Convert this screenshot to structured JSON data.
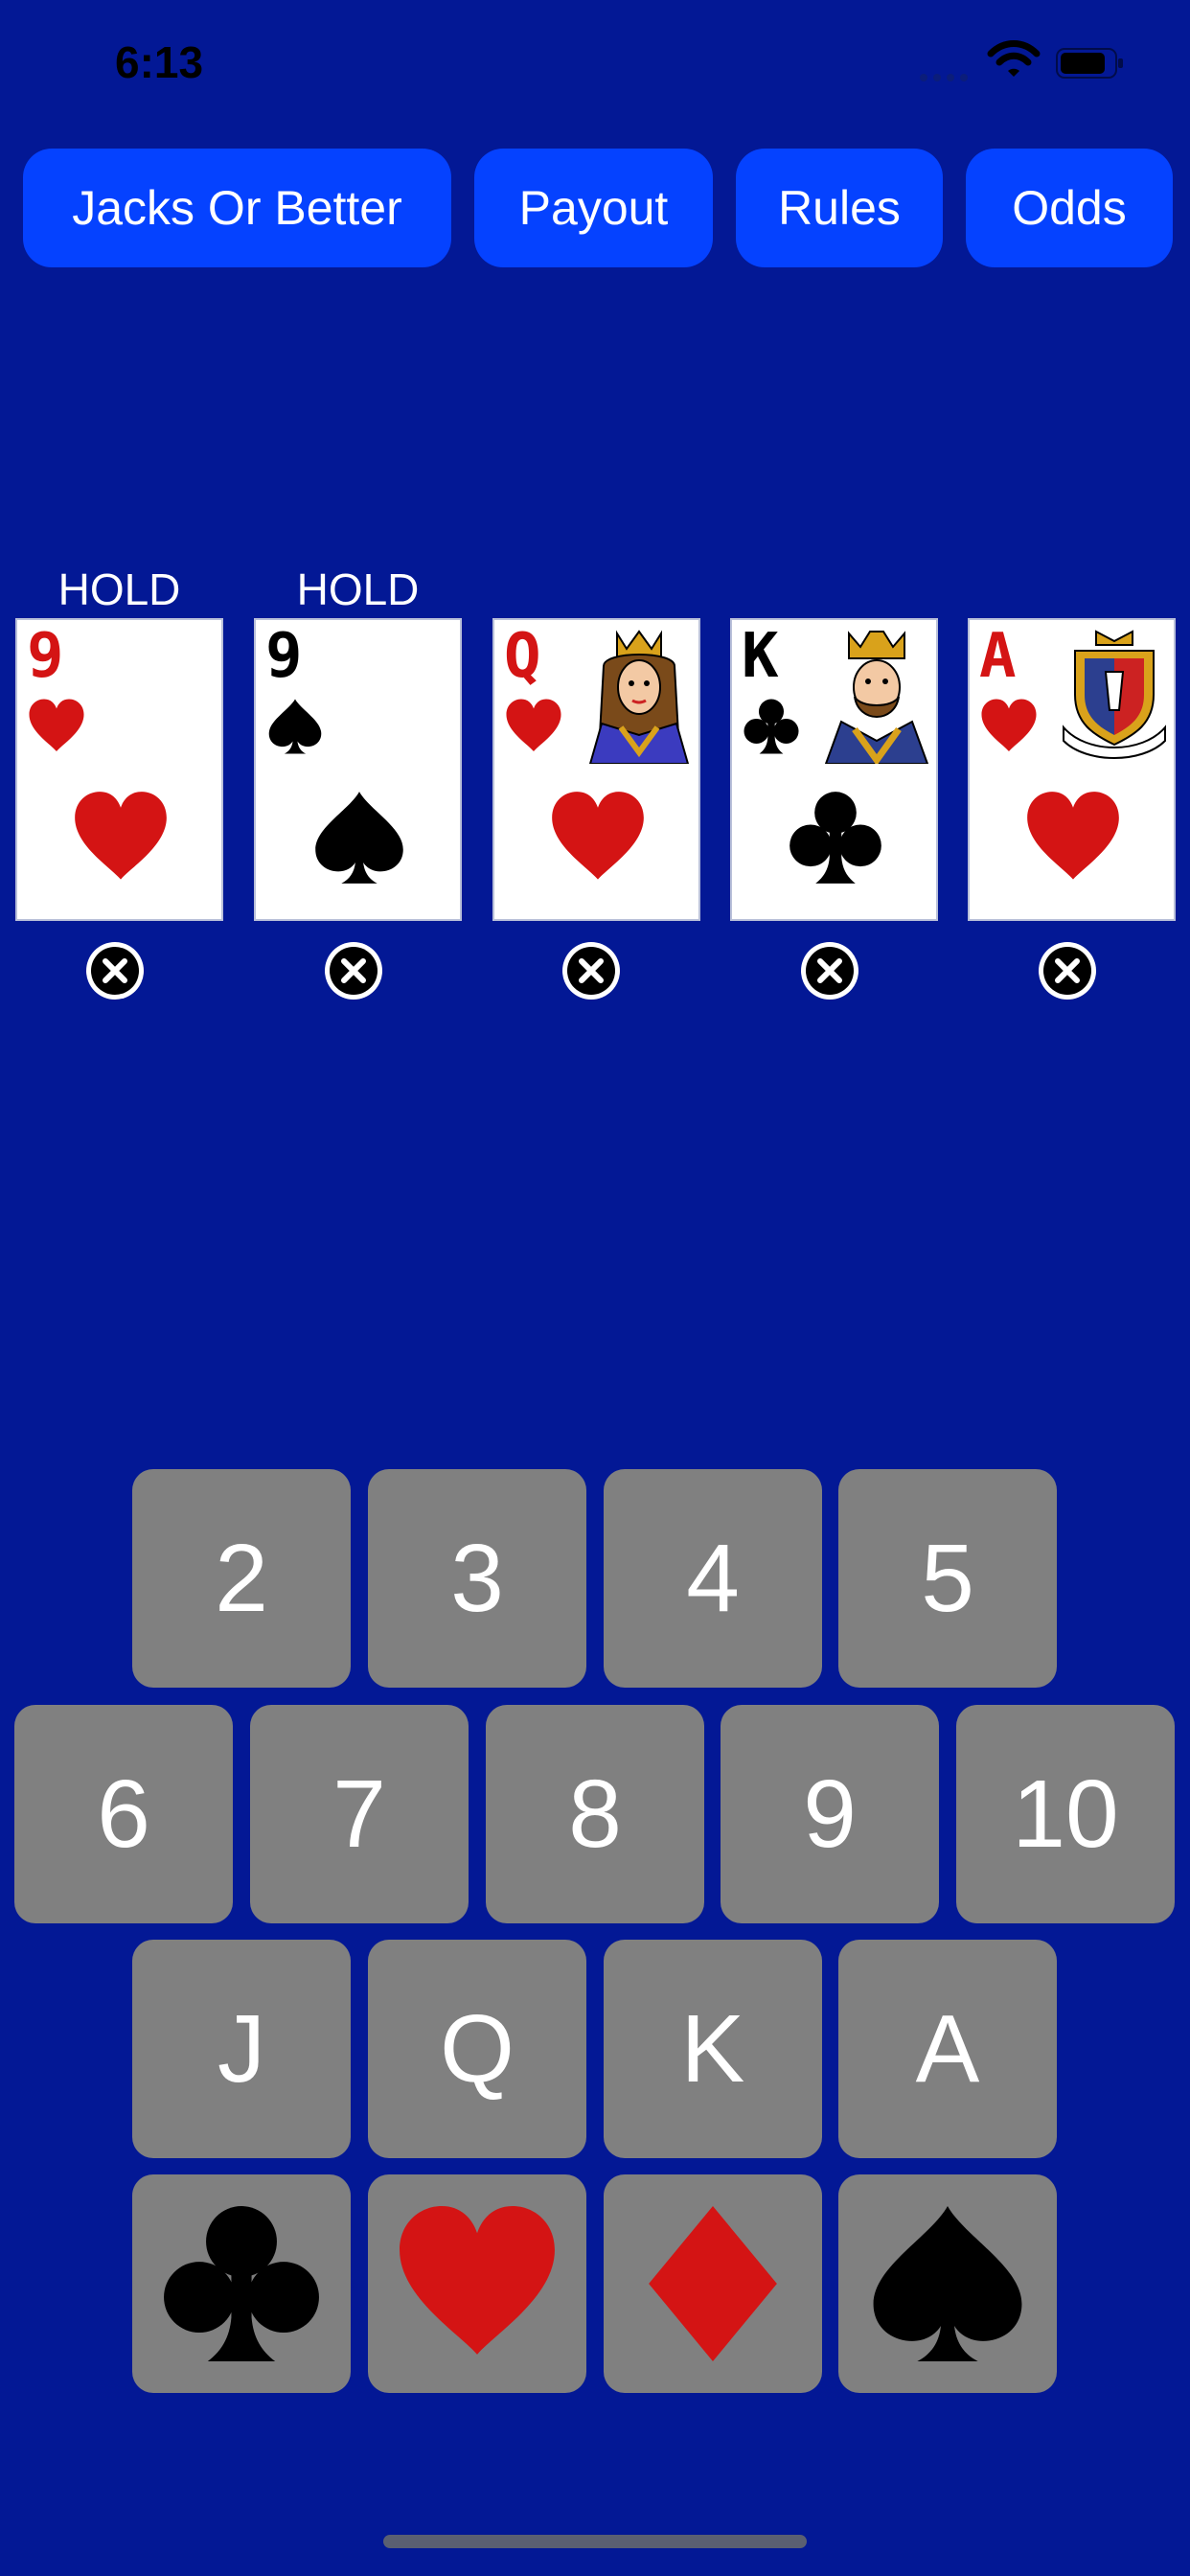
{
  "status_bar": {
    "time": "6:13"
  },
  "nav": {
    "game_button": "Jacks Or Better",
    "payout_button": "Payout",
    "rules_button": "Rules",
    "odds_button": "Odds"
  },
  "hand": [
    {
      "rank": "9",
      "suit": "hearts",
      "hold_label": "HOLD",
      "held": true
    },
    {
      "rank": "9",
      "suit": "spades",
      "hold_label": "HOLD",
      "held": true
    },
    {
      "rank": "Q",
      "suit": "hearts",
      "hold_label": "",
      "held": false
    },
    {
      "rank": "K",
      "suit": "clubs",
      "hold_label": "",
      "held": false
    },
    {
      "rank": "A",
      "suit": "hearts",
      "hold_label": "",
      "held": false
    }
  ],
  "keypad": {
    "ranks_row1": [
      "2",
      "3",
      "4",
      "5"
    ],
    "ranks_row2": [
      "6",
      "7",
      "8",
      "9",
      "10"
    ],
    "ranks_row3": [
      "J",
      "Q",
      "K",
      "A"
    ],
    "suits_row": [
      "clubs-icon",
      "hearts-icon",
      "diamonds-icon",
      "spades-icon"
    ]
  },
  "colors": {
    "background": "#031895",
    "button": "#0542ff",
    "key": "#808080",
    "red_suit": "#d41414",
    "black_suit": "#000000"
  }
}
